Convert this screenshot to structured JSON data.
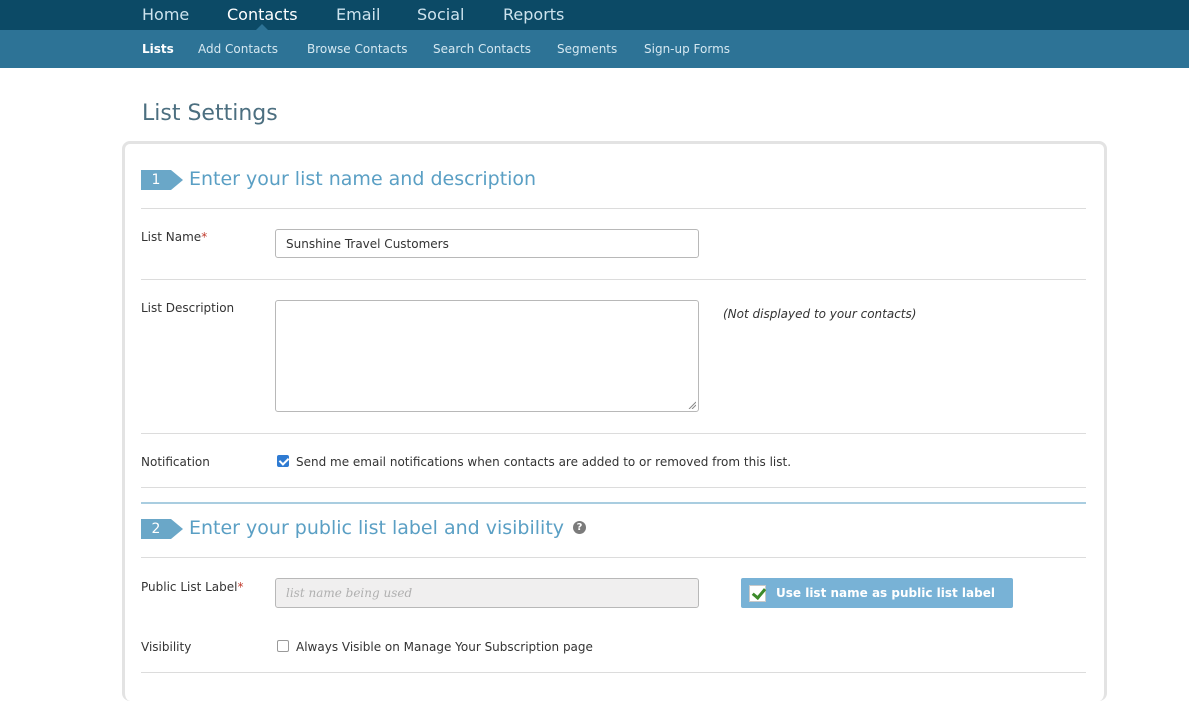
{
  "top_nav": {
    "items": [
      "Home",
      "Contacts",
      "Email",
      "Social",
      "Reports"
    ],
    "active": "Contacts"
  },
  "sub_nav": {
    "items": [
      "Lists",
      "Add Contacts",
      "Browse Contacts",
      "Search Contacts",
      "Segments",
      "Sign-up Forms"
    ],
    "active": "Lists"
  },
  "page_title": "List Settings",
  "section1": {
    "step": "1",
    "title": "Enter your list name and description",
    "list_name_label": "List Name",
    "required_mark": "*",
    "list_name_value": "Sunshine Travel Customers",
    "description_label": "List Description",
    "description_value": "",
    "description_hint": "(Not displayed to your contacts)",
    "notification_label": "Notification",
    "notification_checked": true,
    "notification_text": "Send me email notifications when contacts are added to or removed from this list."
  },
  "section2": {
    "step": "2",
    "title": "Enter your public list label and visibility",
    "help_icon": "?",
    "public_label_label": "Public List Label",
    "required_mark": "*",
    "public_label_placeholder": "list name being used",
    "use_list_name_checked": true,
    "use_list_name_button": "Use list name as public list label",
    "visibility_label": "Visibility",
    "visibility_checked": false,
    "visibility_text": "Always Visible on Manage Your Subscription page"
  },
  "colors": {
    "top_nav_bg": "#0c4a66",
    "sub_nav_bg": "#2d7396",
    "accent": "#5a9fc4",
    "checkbox_blue": "#2f7bd2"
  }
}
